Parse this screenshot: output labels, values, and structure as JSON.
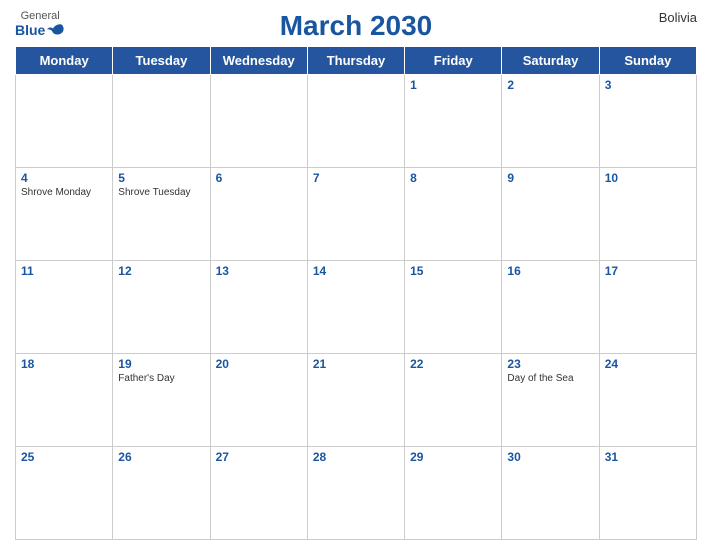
{
  "header": {
    "logo_general": "General",
    "logo_blue": "Blue",
    "title": "March 2030",
    "country": "Bolivia"
  },
  "days_of_week": [
    "Monday",
    "Tuesday",
    "Wednesday",
    "Thursday",
    "Friday",
    "Saturday",
    "Sunday"
  ],
  "weeks": [
    [
      {
        "day": "",
        "holiday": ""
      },
      {
        "day": "",
        "holiday": ""
      },
      {
        "day": "",
        "holiday": ""
      },
      {
        "day": "",
        "holiday": ""
      },
      {
        "day": "1",
        "holiday": ""
      },
      {
        "day": "2",
        "holiday": ""
      },
      {
        "day": "3",
        "holiday": ""
      }
    ],
    [
      {
        "day": "4",
        "holiday": "Shrove Monday"
      },
      {
        "day": "5",
        "holiday": "Shrove Tuesday"
      },
      {
        "day": "6",
        "holiday": ""
      },
      {
        "day": "7",
        "holiday": ""
      },
      {
        "day": "8",
        "holiday": ""
      },
      {
        "day": "9",
        "holiday": ""
      },
      {
        "day": "10",
        "holiday": ""
      }
    ],
    [
      {
        "day": "11",
        "holiday": ""
      },
      {
        "day": "12",
        "holiday": ""
      },
      {
        "day": "13",
        "holiday": ""
      },
      {
        "day": "14",
        "holiday": ""
      },
      {
        "day": "15",
        "holiday": ""
      },
      {
        "day": "16",
        "holiday": ""
      },
      {
        "day": "17",
        "holiday": ""
      }
    ],
    [
      {
        "day": "18",
        "holiday": ""
      },
      {
        "day": "19",
        "holiday": "Father's Day"
      },
      {
        "day": "20",
        "holiday": ""
      },
      {
        "day": "21",
        "holiday": ""
      },
      {
        "day": "22",
        "holiday": ""
      },
      {
        "day": "23",
        "holiday": "Day of the Sea"
      },
      {
        "day": "24",
        "holiday": ""
      }
    ],
    [
      {
        "day": "25",
        "holiday": ""
      },
      {
        "day": "26",
        "holiday": ""
      },
      {
        "day": "27",
        "holiday": ""
      },
      {
        "day": "28",
        "holiday": ""
      },
      {
        "day": "29",
        "holiday": ""
      },
      {
        "day": "30",
        "holiday": ""
      },
      {
        "day": "31",
        "holiday": ""
      }
    ]
  ]
}
